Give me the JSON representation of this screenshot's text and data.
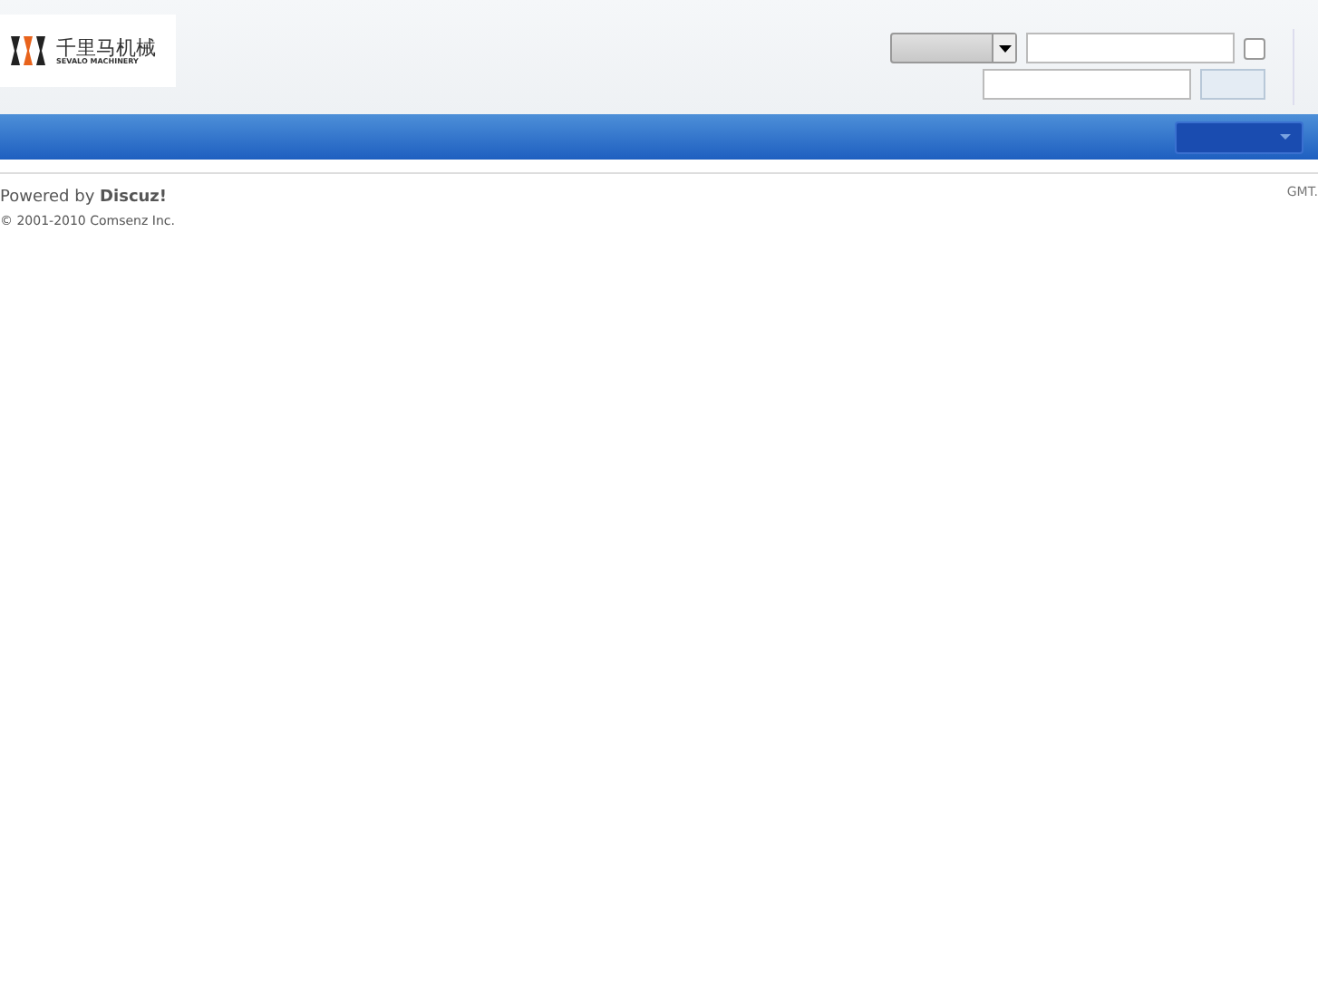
{
  "logo": {
    "name": "千里马机械",
    "subtitle": "SEVALO MACHINERY"
  },
  "login": {
    "remember": {
      "checked": false
    }
  },
  "footer": {
    "powered": "Powered by **Discuz!**",
    "copyright": "© 2001-2010 Comsenz Inc.",
    "timezone": "GMT."
  }
}
